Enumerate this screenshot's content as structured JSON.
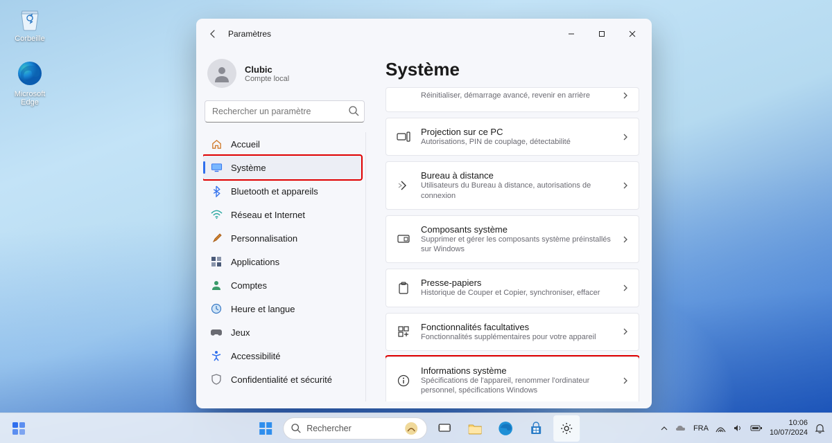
{
  "desktop": {
    "recycle_bin": "Corbeille",
    "edge": "Microsoft Edge"
  },
  "window": {
    "title": "Paramètres",
    "user": {
      "name": "Clubic",
      "subtitle": "Compte local"
    },
    "search_placeholder": "Rechercher un paramètre",
    "nav": [
      {
        "label": "Accueil",
        "icon": "home"
      },
      {
        "label": "Système",
        "icon": "system",
        "selected": true,
        "highlighted": true
      },
      {
        "label": "Bluetooth et appareils",
        "icon": "bluetooth"
      },
      {
        "label": "Réseau et Internet",
        "icon": "wifi"
      },
      {
        "label": "Personnalisation",
        "icon": "brush"
      },
      {
        "label": "Applications",
        "icon": "apps"
      },
      {
        "label": "Comptes",
        "icon": "account"
      },
      {
        "label": "Heure et langue",
        "icon": "time"
      },
      {
        "label": "Jeux",
        "icon": "games"
      },
      {
        "label": "Accessibilité",
        "icon": "accessibility"
      },
      {
        "label": "Confidentialité et sécurité",
        "icon": "privacy"
      }
    ],
    "main_title": "Système",
    "cards": [
      {
        "title": "",
        "subtitle": "Réinitialiser, démarrage avancé, revenir en arrière",
        "icon": "",
        "fragment": true
      },
      {
        "title": "Projection sur ce PC",
        "subtitle": "Autorisations, PIN de couplage, détectabilité",
        "icon": "project"
      },
      {
        "title": "Bureau à distance",
        "subtitle": "Utilisateurs du Bureau à distance, autorisations de connexion",
        "icon": "remote"
      },
      {
        "title": "Composants système",
        "subtitle": "Supprimer et gérer les composants système préinstallés sur Windows",
        "icon": "components"
      },
      {
        "title": "Presse-papiers",
        "subtitle": "Historique de Couper et Copier, synchroniser, effacer",
        "icon": "clipboard"
      },
      {
        "title": "Fonctionnalités facultatives",
        "subtitle": "Fonctionnalités supplémentaires pour votre appareil",
        "icon": "optional"
      },
      {
        "title": "Informations système",
        "subtitle": "Spécifications de l'appareil, renommer l'ordinateur personnel, spécifications Windows",
        "icon": "info",
        "highlighted": true
      }
    ]
  },
  "taskbar": {
    "search_placeholder": "Rechercher",
    "time": "10:06",
    "date": "10/07/2024"
  }
}
